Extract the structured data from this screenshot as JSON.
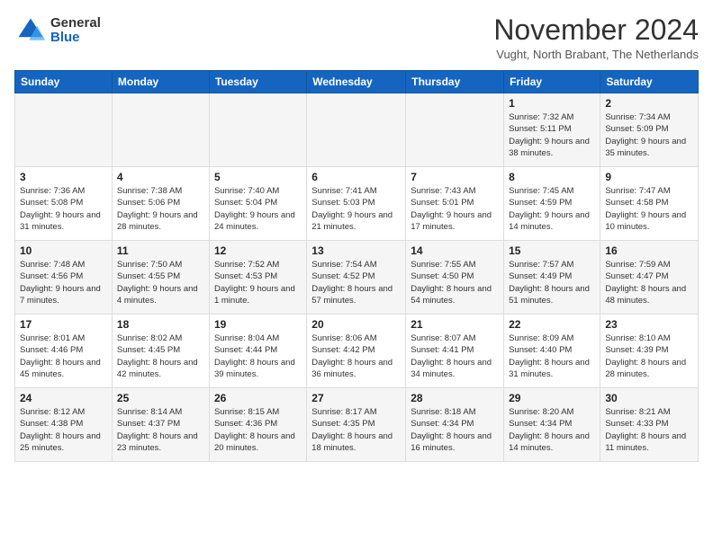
{
  "logo": {
    "general": "General",
    "blue": "Blue"
  },
  "header": {
    "month": "November 2024",
    "location": "Vught, North Brabant, The Netherlands"
  },
  "weekdays": [
    "Sunday",
    "Monday",
    "Tuesday",
    "Wednesday",
    "Thursday",
    "Friday",
    "Saturday"
  ],
  "weeks": [
    [
      {
        "day": "",
        "info": ""
      },
      {
        "day": "",
        "info": ""
      },
      {
        "day": "",
        "info": ""
      },
      {
        "day": "",
        "info": ""
      },
      {
        "day": "",
        "info": ""
      },
      {
        "day": "1",
        "info": "Sunrise: 7:32 AM\nSunset: 5:11 PM\nDaylight: 9 hours and 38 minutes."
      },
      {
        "day": "2",
        "info": "Sunrise: 7:34 AM\nSunset: 5:09 PM\nDaylight: 9 hours and 35 minutes."
      }
    ],
    [
      {
        "day": "3",
        "info": "Sunrise: 7:36 AM\nSunset: 5:08 PM\nDaylight: 9 hours and 31 minutes."
      },
      {
        "day": "4",
        "info": "Sunrise: 7:38 AM\nSunset: 5:06 PM\nDaylight: 9 hours and 28 minutes."
      },
      {
        "day": "5",
        "info": "Sunrise: 7:40 AM\nSunset: 5:04 PM\nDaylight: 9 hours and 24 minutes."
      },
      {
        "day": "6",
        "info": "Sunrise: 7:41 AM\nSunset: 5:03 PM\nDaylight: 9 hours and 21 minutes."
      },
      {
        "day": "7",
        "info": "Sunrise: 7:43 AM\nSunset: 5:01 PM\nDaylight: 9 hours and 17 minutes."
      },
      {
        "day": "8",
        "info": "Sunrise: 7:45 AM\nSunset: 4:59 PM\nDaylight: 9 hours and 14 minutes."
      },
      {
        "day": "9",
        "info": "Sunrise: 7:47 AM\nSunset: 4:58 PM\nDaylight: 9 hours and 10 minutes."
      }
    ],
    [
      {
        "day": "10",
        "info": "Sunrise: 7:48 AM\nSunset: 4:56 PM\nDaylight: 9 hours and 7 minutes."
      },
      {
        "day": "11",
        "info": "Sunrise: 7:50 AM\nSunset: 4:55 PM\nDaylight: 9 hours and 4 minutes."
      },
      {
        "day": "12",
        "info": "Sunrise: 7:52 AM\nSunset: 4:53 PM\nDaylight: 9 hours and 1 minute."
      },
      {
        "day": "13",
        "info": "Sunrise: 7:54 AM\nSunset: 4:52 PM\nDaylight: 8 hours and 57 minutes."
      },
      {
        "day": "14",
        "info": "Sunrise: 7:55 AM\nSunset: 4:50 PM\nDaylight: 8 hours and 54 minutes."
      },
      {
        "day": "15",
        "info": "Sunrise: 7:57 AM\nSunset: 4:49 PM\nDaylight: 8 hours and 51 minutes."
      },
      {
        "day": "16",
        "info": "Sunrise: 7:59 AM\nSunset: 4:47 PM\nDaylight: 8 hours and 48 minutes."
      }
    ],
    [
      {
        "day": "17",
        "info": "Sunrise: 8:01 AM\nSunset: 4:46 PM\nDaylight: 8 hours and 45 minutes."
      },
      {
        "day": "18",
        "info": "Sunrise: 8:02 AM\nSunset: 4:45 PM\nDaylight: 8 hours and 42 minutes."
      },
      {
        "day": "19",
        "info": "Sunrise: 8:04 AM\nSunset: 4:44 PM\nDaylight: 8 hours and 39 minutes."
      },
      {
        "day": "20",
        "info": "Sunrise: 8:06 AM\nSunset: 4:42 PM\nDaylight: 8 hours and 36 minutes."
      },
      {
        "day": "21",
        "info": "Sunrise: 8:07 AM\nSunset: 4:41 PM\nDaylight: 8 hours and 34 minutes."
      },
      {
        "day": "22",
        "info": "Sunrise: 8:09 AM\nSunset: 4:40 PM\nDaylight: 8 hours and 31 minutes."
      },
      {
        "day": "23",
        "info": "Sunrise: 8:10 AM\nSunset: 4:39 PM\nDaylight: 8 hours and 28 minutes."
      }
    ],
    [
      {
        "day": "24",
        "info": "Sunrise: 8:12 AM\nSunset: 4:38 PM\nDaylight: 8 hours and 25 minutes."
      },
      {
        "day": "25",
        "info": "Sunrise: 8:14 AM\nSunset: 4:37 PM\nDaylight: 8 hours and 23 minutes."
      },
      {
        "day": "26",
        "info": "Sunrise: 8:15 AM\nSunset: 4:36 PM\nDaylight: 8 hours and 20 minutes."
      },
      {
        "day": "27",
        "info": "Sunrise: 8:17 AM\nSunset: 4:35 PM\nDaylight: 8 hours and 18 minutes."
      },
      {
        "day": "28",
        "info": "Sunrise: 8:18 AM\nSunset: 4:34 PM\nDaylight: 8 hours and 16 minutes."
      },
      {
        "day": "29",
        "info": "Sunrise: 8:20 AM\nSunset: 4:34 PM\nDaylight: 8 hours and 14 minutes."
      },
      {
        "day": "30",
        "info": "Sunrise: 8:21 AM\nSunset: 4:33 PM\nDaylight: 8 hours and 11 minutes."
      }
    ]
  ]
}
